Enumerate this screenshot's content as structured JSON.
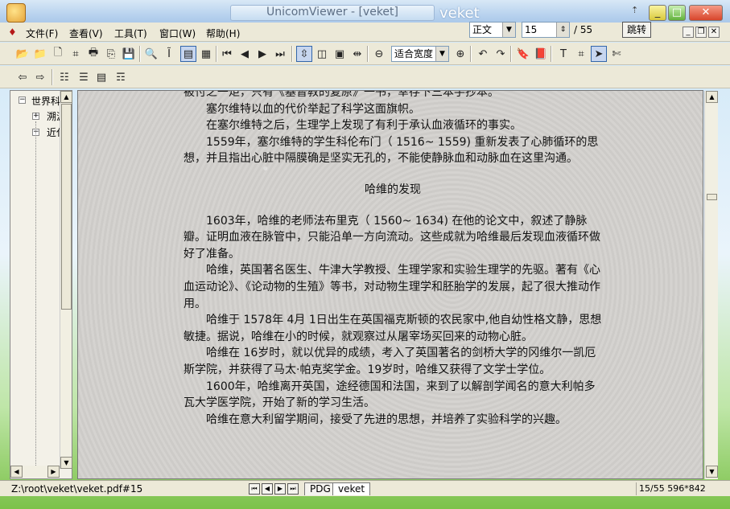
{
  "window": {
    "title": "UnicomViewer - [veket]",
    "overlay_title": "veket",
    "minimize": "_",
    "maximize": "□",
    "close": "✕",
    "arrow": "⇡"
  },
  "menubar": {
    "items": [
      {
        "label": "文件(F)"
      },
      {
        "label": "查看(V)"
      },
      {
        "label": "工具(T)"
      },
      {
        "label": "窗口(W)"
      },
      {
        "label": "帮助(H)"
      }
    ],
    "mdi": {
      "min": "_",
      "restore": "❐",
      "close": "✕"
    }
  },
  "navigation": {
    "style_value": "正文",
    "page_value": "15",
    "page_total": "/ 55",
    "jump_label": "跳转"
  },
  "toolbar": {
    "zoom_value": "适合宽度"
  },
  "tree": {
    "items": [
      {
        "toggle": "-",
        "label": "世界科"
      },
      {
        "toggle": "+",
        "label": "溯源"
      },
      {
        "toggle": "-",
        "label": "近代"
      }
    ]
  },
  "document": {
    "paragraphs": [
      {
        "text": "被付之一炬，只有《基督教的复原》一书，幸存下三本手抄本。",
        "indent": false
      },
      {
        "text": "塞尔维特以血的代价举起了科学这面旗帜。",
        "indent": true
      },
      {
        "text": "在塞尔维特之后，生理学上发现了有利于承认血液循环的事实。",
        "indent": true
      },
      {
        "text": "1559年，塞尔维特的学生科伦布门（ 1516~ 1559) 重新发表了心肺循环的思想，并且指出心脏中隔膜确是坚实无孔的，不能使静脉血和动脉血在这里沟通。",
        "indent": true
      }
    ],
    "heading": "哈维的发现",
    "paragraphs2": [
      {
        "text": "1603年，哈维的老师法布里克（ 1560~ 1634) 在他的论文中，叙述了静脉瓣。证明血液在脉管中，只能沿单一方向流动。这些成就为哈维最后发现血液循环做好了准备。"
      },
      {
        "text": "哈维，英国著名医生、牛津大学教授、生理学家和实验生理学的先驱。著有《心血运动论》、《论动物的生殖》等书，对动物生理学和胚胎学的发展，起了很大推动作用。"
      },
      {
        "text": "哈维于  1578年  4月  1日出生在英国福克斯顿的农民家中,他自幼性格文静，思想敏捷。据说，哈维在小的时候，就观察过从屠宰场买回来的动物心脏。"
      },
      {
        "text": "哈维在  16岁时，就以优异的成绩，考入了英国著名的剑桥大学的冈维尔一凯厄斯学院，并获得了马太·帕克奖学金。19岁时，哈维又获得了文学士学位。"
      },
      {
        "text": "1600年，哈维离开英国，途经德国和法国，来到了以解剖学闻名的意大利帕多瓦大学医学院，开始了新的学习生活。"
      },
      {
        "text": "哈维在意大利留学期间，接受了先进的思想，并培养了实验科学的兴趣。"
      }
    ]
  },
  "statusbar": {
    "path": "Z:\\root\\veket\\veket.pdf#15",
    "tabs": [
      {
        "label": "PDG"
      },
      {
        "label": "veket"
      }
    ],
    "page_info": "15/55  596*842"
  }
}
